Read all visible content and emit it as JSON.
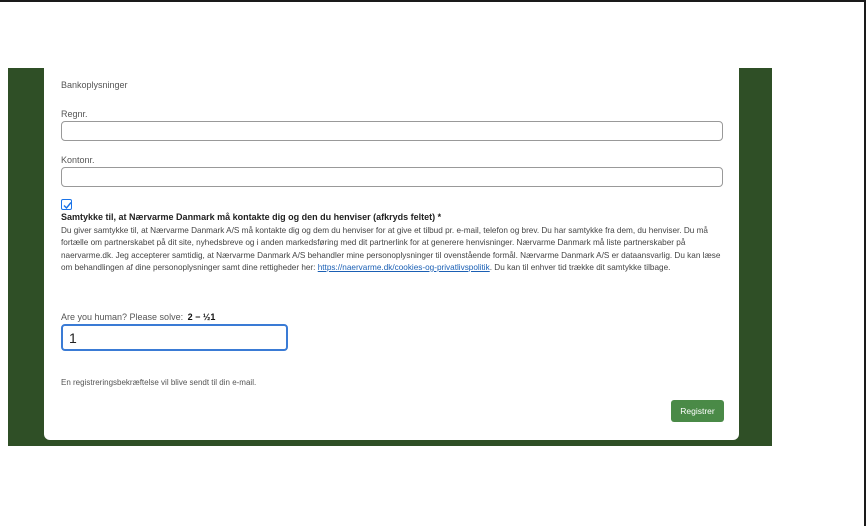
{
  "form": {
    "section_title": "Bankoplysninger",
    "regnr_label": "Regnr.",
    "regnr_value": "",
    "kontonr_label": "Kontonr.",
    "kontonr_value": "",
    "consent_checked": true,
    "consent_heading": "Samtykke til, at Nærvarme Danmark må kontakte dig og den du henviser (afkryds feltet) *",
    "consent_text_before_link": "Du giver samtykke til, at Nærvarme Danmark A/S må kontakte dig og dem du henviser for at give et tilbud pr. e-mail, telefon og brev. Du har samtykke fra dem, du henviser. Du må fortælle om partnerskabet på dit site, nyhedsbreve og i anden markedsføring med dit partnerlink for at generere henvisninger. Nærvarme Danmark må liste partnerskaber på naervarme.dk. Jeg accepterer samtidig, at Nærvarme Danmark A/S behandler mine personoplysninger til ovenstående formål. Nærvarme Danmark A/S er dataansvarlig. Du kan læse om behandlingen af dine personoplysninger samt dine rettigheder her: ",
    "consent_link": "https://naervarme.dk/cookies-og-privatlivspolitik",
    "consent_text_after_link": ". Du kan til enhver tid trække dit samtykke tilbage.",
    "captcha_label": "Are you human? Please solve:",
    "captcha_formula": "2 − ½1",
    "captcha_value": "1",
    "confirmation_note": "En registreringsbekræftelse vil blive sendt til din e-mail.",
    "submit_label": "Registrer"
  },
  "colors": {
    "page_background": "#ffffff",
    "side_panel": "#2f4f26",
    "button": "#4a8a47",
    "focus_border": "#3a7bd5",
    "link": "#1a5fb4"
  }
}
